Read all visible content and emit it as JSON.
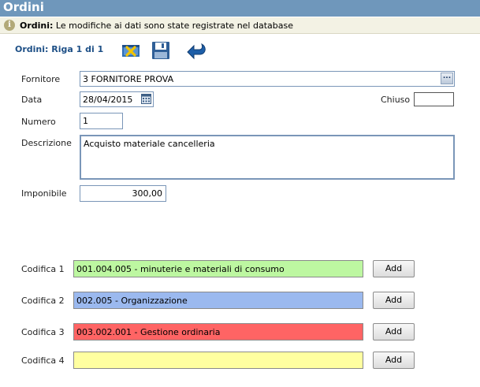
{
  "window": {
    "title": "Ordini"
  },
  "info": {
    "prefix": "Ordini:",
    "message": "Le modifiche ai dati sono state registrate nel database"
  },
  "toolbar": {
    "record_label": "Ordini: Riga 1 di 1"
  },
  "form": {
    "fornitore": {
      "label": "Fornitore",
      "value": "3 FORNITORE PROVA",
      "button": "..."
    },
    "data": {
      "label": "Data",
      "value": "28/04/2015"
    },
    "chiuso": {
      "label": "Chiuso",
      "checked": false
    },
    "numero": {
      "label": "Numero",
      "value": "1"
    },
    "descrizione": {
      "label": "Descrizione",
      "value": "Acquisto materiale cancelleria"
    },
    "imponibile": {
      "label": "Imponibile",
      "value": "300,00"
    }
  },
  "codifiche": [
    {
      "label": "Codifica 1",
      "value": "001.004.005 - minuterie e materiali di consumo",
      "color": "#bdf7a1",
      "button": "Add"
    },
    {
      "label": "Codifica 2",
      "value": "002.005 - Organizzazione",
      "color": "#9bb9ef",
      "button": "Add"
    },
    {
      "label": "Codifica 3",
      "value": "003.002.001 - Gestione ordinaria",
      "color": "#ff6464",
      "button": "Add"
    },
    {
      "label": "Codifica 4",
      "value": "",
      "color": "#ffffa0",
      "button": "Add"
    }
  ]
}
